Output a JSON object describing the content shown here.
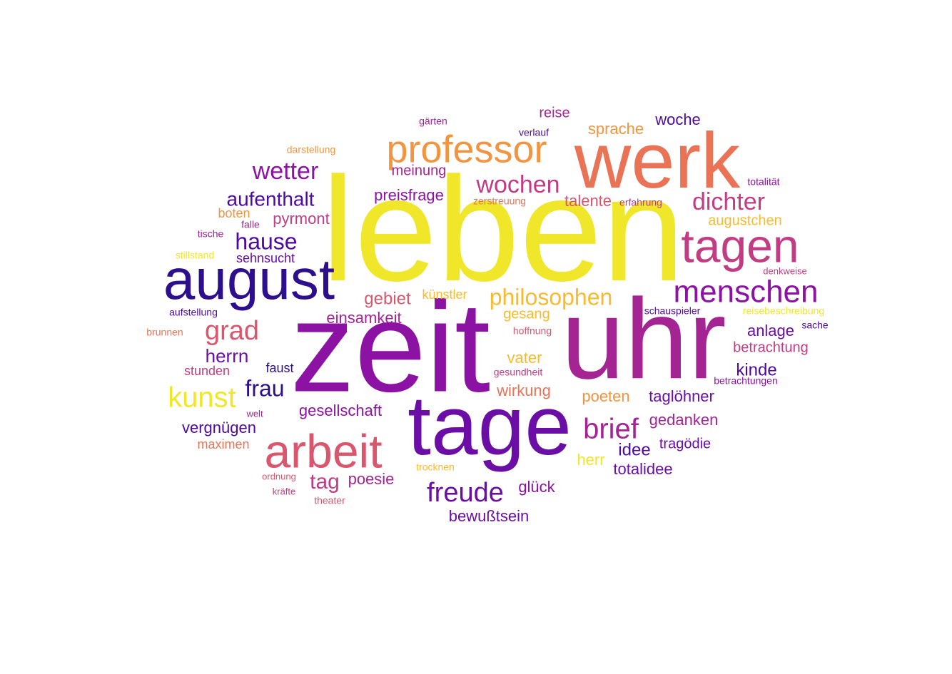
{
  "word_cloud": {
    "palette": {
      "c0": "#2d0e8c",
      "c1": "#4d0aa0",
      "c2": "#6a0ea6",
      "c3": "#8b12a3",
      "c4": "#a42494",
      "c5": "#c23c84",
      "c6": "#d9566d",
      "c7": "#ea7356",
      "c8": "#f39440",
      "c9": "#f8bb2e",
      "c10": "#f0e72b"
    },
    "words": [
      {
        "text": "leben",
        "color": "c10"
      },
      {
        "text": "zeit",
        "color": "c3"
      },
      {
        "text": "uhr",
        "color": "c4"
      },
      {
        "text": "tage",
        "color": "c2"
      },
      {
        "text": "werk",
        "color": "c7"
      },
      {
        "text": "august",
        "color": "c0"
      },
      {
        "text": "arbeit",
        "color": "c6"
      },
      {
        "text": "tagen",
        "color": "c5"
      },
      {
        "text": "professor",
        "color": "c8"
      },
      {
        "text": "menschen",
        "color": "c3"
      },
      {
        "text": "brief",
        "color": "c4"
      },
      {
        "text": "kunst",
        "color": "c10"
      },
      {
        "text": "grad",
        "color": "c6"
      },
      {
        "text": "freude",
        "color": "c2"
      },
      {
        "text": "wetter",
        "color": "c3"
      },
      {
        "text": "wochen",
        "color": "c5"
      },
      {
        "text": "dichter",
        "color": "c5"
      },
      {
        "text": "philosophen",
        "color": "c9"
      },
      {
        "text": "hause",
        "color": "c1"
      },
      {
        "text": "frau",
        "color": "c0"
      },
      {
        "text": "aufenthalt",
        "color": "c1"
      },
      {
        "text": "tag",
        "color": "c5"
      },
      {
        "text": "herrn",
        "color": "c2"
      },
      {
        "text": "einsamkeit",
        "color": "c4"
      },
      {
        "text": "gebiet",
        "color": "c6"
      },
      {
        "text": "preisfrage",
        "color": "c3"
      },
      {
        "text": "pyrmont",
        "color": "c5"
      },
      {
        "text": "sprache",
        "color": "c8"
      },
      {
        "text": "woche",
        "color": "c1"
      },
      {
        "text": "reise",
        "color": "c4"
      },
      {
        "text": "talente",
        "color": "c6"
      },
      {
        "text": "augustchen",
        "color": "c9"
      },
      {
        "text": "anlage",
        "color": "c2"
      },
      {
        "text": "betrachtung",
        "color": "c5"
      },
      {
        "text": "kinde",
        "color": "c1"
      },
      {
        "text": "taglöhner",
        "color": "c2"
      },
      {
        "text": "gedanken",
        "color": "c4"
      },
      {
        "text": "idee",
        "color": "c1"
      },
      {
        "text": "tragödie",
        "color": "c2"
      },
      {
        "text": "totalidee",
        "color": "c2"
      },
      {
        "text": "herr",
        "color": "c10"
      },
      {
        "text": "poeten",
        "color": "c8"
      },
      {
        "text": "wirkung",
        "color": "c7"
      },
      {
        "text": "vater",
        "color": "c9"
      },
      {
        "text": "gesang",
        "color": "c9"
      },
      {
        "text": "künstler",
        "color": "c9"
      },
      {
        "text": "meinung",
        "color": "c4"
      },
      {
        "text": "gesellschaft",
        "color": "c3"
      },
      {
        "text": "vergnügen",
        "color": "c1"
      },
      {
        "text": "poesie",
        "color": "c4"
      },
      {
        "text": "glück",
        "color": "c3"
      },
      {
        "text": "bewußtsein",
        "color": "c2"
      },
      {
        "text": "stunden",
        "color": "c5"
      },
      {
        "text": "faust",
        "color": "c0"
      },
      {
        "text": "maximen",
        "color": "c7"
      },
      {
        "text": "boten",
        "color": "c8"
      },
      {
        "text": "sehnsucht",
        "color": "c2"
      },
      {
        "text": "gärten",
        "color": "c4"
      },
      {
        "text": "verlauf",
        "color": "c1"
      },
      {
        "text": "darstellung",
        "color": "c8"
      },
      {
        "text": "zerstreuung",
        "color": "c7"
      },
      {
        "text": "erfahrung",
        "color": "c5"
      },
      {
        "text": "totalität",
        "color": "c3"
      },
      {
        "text": "falle",
        "color": "c4"
      },
      {
        "text": "tische",
        "color": "c4"
      },
      {
        "text": "stillstand",
        "color": "c10"
      },
      {
        "text": "denkweise",
        "color": "c5"
      },
      {
        "text": "aufstellung",
        "color": "c1"
      },
      {
        "text": "schauspieler",
        "color": "c1"
      },
      {
        "text": "reisebeschreibung",
        "color": "c10"
      },
      {
        "text": "brunnen",
        "color": "c7"
      },
      {
        "text": "hoffnung",
        "color": "c6"
      },
      {
        "text": "sache",
        "color": "c1"
      },
      {
        "text": "gesundheit",
        "color": "c5"
      },
      {
        "text": "betrachtungen",
        "color": "c3"
      },
      {
        "text": "welt",
        "color": "c4"
      },
      {
        "text": "ordnung",
        "color": "c6"
      },
      {
        "text": "trocknen",
        "color": "c9"
      },
      {
        "text": "kräfte",
        "color": "c5"
      },
      {
        "text": "theater",
        "color": "c6"
      }
    ]
  }
}
